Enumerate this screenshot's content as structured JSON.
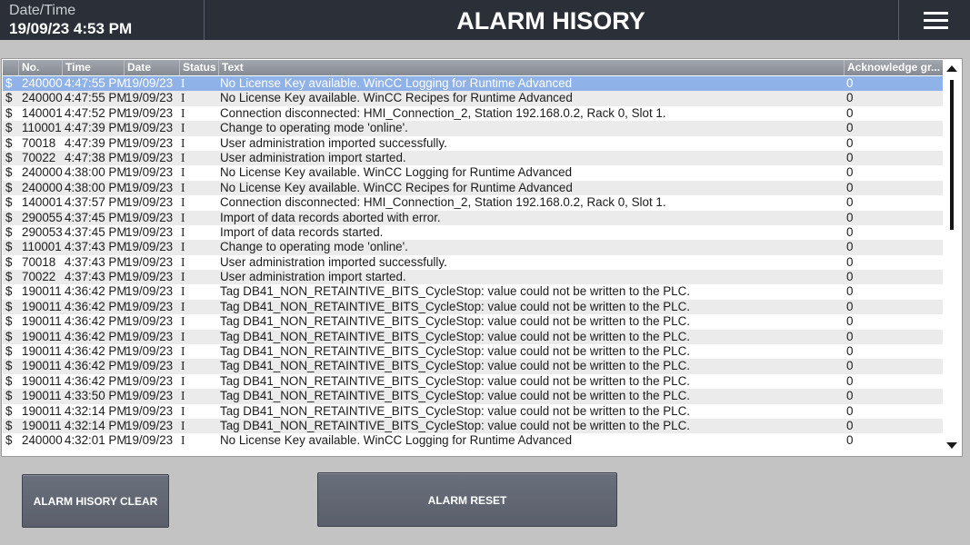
{
  "header": {
    "datetime_label": "Date/Time",
    "datetime_value": "19/09/23 4:53 PM",
    "title": "ALARM HISORY",
    "menu_icon": "hamburger-menu-icon"
  },
  "alarm_view": {
    "columns": {
      "no": "No.",
      "time": "Time",
      "date": "Date",
      "status": "Status",
      "text": "Text",
      "ack": "Acknowledge gr..."
    },
    "selected_row": 0,
    "rows": [
      {
        "icon": "$",
        "no": "240000",
        "time": "4:47:55 PM",
        "date": "19/09/23",
        "status": "I",
        "text": "No License Key available. WinCC Logging for Runtime Advanced",
        "ack": "0"
      },
      {
        "icon": "$",
        "no": "240000",
        "time": "4:47:55 PM",
        "date": "19/09/23",
        "status": "I",
        "text": "No License Key available. WinCC Recipes for Runtime Advanced",
        "ack": "0"
      },
      {
        "icon": "$",
        "no": "140001",
        "time": "4:47:52 PM",
        "date": "19/09/23",
        "status": "I",
        "text": "Connection disconnected: HMI_Connection_2, Station 192.168.0.2, Rack 0, Slot 1.",
        "ack": "0"
      },
      {
        "icon": "$",
        "no": "110001",
        "time": "4:47:39 PM",
        "date": "19/09/23",
        "status": "I",
        "text": "Change to operating mode 'online'.",
        "ack": "0"
      },
      {
        "icon": "$",
        "no": "70018",
        "time": "4:47:39 PM",
        "date": "19/09/23",
        "status": "I",
        "text": "User administration imported successfully.",
        "ack": "0"
      },
      {
        "icon": "$",
        "no": "70022",
        "time": "4:47:38 PM",
        "date": "19/09/23",
        "status": "I",
        "text": "User administration import started.",
        "ack": "0"
      },
      {
        "icon": "$",
        "no": "240000",
        "time": "4:38:00 PM",
        "date": "19/09/23",
        "status": "I",
        "text": "No License Key available. WinCC Logging for Runtime Advanced",
        "ack": "0"
      },
      {
        "icon": "$",
        "no": "240000",
        "time": "4:38:00 PM",
        "date": "19/09/23",
        "status": "I",
        "text": "No License Key available. WinCC Recipes for Runtime Advanced",
        "ack": "0"
      },
      {
        "icon": "$",
        "no": "140001",
        "time": "4:37:57 PM",
        "date": "19/09/23",
        "status": "I",
        "text": "Connection disconnected: HMI_Connection_2, Station 192.168.0.2, Rack 0, Slot 1.",
        "ack": "0"
      },
      {
        "icon": "$",
        "no": "290055",
        "time": "4:37:45 PM",
        "date": "19/09/23",
        "status": "I",
        "text": "Import of data records aborted with error.",
        "ack": "0"
      },
      {
        "icon": "$",
        "no": "290053",
        "time": "4:37:45 PM",
        "date": "19/09/23",
        "status": "I",
        "text": "Import of data records started.",
        "ack": "0"
      },
      {
        "icon": "$",
        "no": "110001",
        "time": "4:37:43 PM",
        "date": "19/09/23",
        "status": "I",
        "text": "Change to operating mode 'online'.",
        "ack": "0"
      },
      {
        "icon": "$",
        "no": "70018",
        "time": "4:37:43 PM",
        "date": "19/09/23",
        "status": "I",
        "text": "User administration imported successfully.",
        "ack": "0"
      },
      {
        "icon": "$",
        "no": "70022",
        "time": "4:37:43 PM",
        "date": "19/09/23",
        "status": "I",
        "text": "User administration import started.",
        "ack": "0"
      },
      {
        "icon": "$",
        "no": "190011",
        "time": "4:36:42 PM",
        "date": "19/09/23",
        "status": "I",
        "text": "Tag DB41_NON_RETAINTIVE_BITS_CycleStop: value could not be written to the PLC.",
        "ack": "0"
      },
      {
        "icon": "$",
        "no": "190011",
        "time": "4:36:42 PM",
        "date": "19/09/23",
        "status": "I",
        "text": "Tag DB41_NON_RETAINTIVE_BITS_CycleStop: value could not be written to the PLC.",
        "ack": "0"
      },
      {
        "icon": "$",
        "no": "190011",
        "time": "4:36:42 PM",
        "date": "19/09/23",
        "status": "I",
        "text": "Tag DB41_NON_RETAINTIVE_BITS_CycleStop: value could not be written to the PLC.",
        "ack": "0"
      },
      {
        "icon": "$",
        "no": "190011",
        "time": "4:36:42 PM",
        "date": "19/09/23",
        "status": "I",
        "text": "Tag DB41_NON_RETAINTIVE_BITS_CycleStop: value could not be written to the PLC.",
        "ack": "0"
      },
      {
        "icon": "$",
        "no": "190011",
        "time": "4:36:42 PM",
        "date": "19/09/23",
        "status": "I",
        "text": "Tag DB41_NON_RETAINTIVE_BITS_CycleStop: value could not be written to the PLC.",
        "ack": "0"
      },
      {
        "icon": "$",
        "no": "190011",
        "time": "4:36:42 PM",
        "date": "19/09/23",
        "status": "I",
        "text": "Tag DB41_NON_RETAINTIVE_BITS_CycleStop: value could not be written to the PLC.",
        "ack": "0"
      },
      {
        "icon": "$",
        "no": "190011",
        "time": "4:36:42 PM",
        "date": "19/09/23",
        "status": "I",
        "text": "Tag DB41_NON_RETAINTIVE_BITS_CycleStop: value could not be written to the PLC.",
        "ack": "0"
      },
      {
        "icon": "$",
        "no": "190011",
        "time": "4:33:50 PM",
        "date": "19/09/23",
        "status": "I",
        "text": "Tag DB41_NON_RETAINTIVE_BITS_CycleStop: value could not be written to the PLC.",
        "ack": "0"
      },
      {
        "icon": "$",
        "no": "190011",
        "time": "4:32:14 PM",
        "date": "19/09/23",
        "status": "I",
        "text": "Tag DB41_NON_RETAINTIVE_BITS_CycleStop: value could not be written to the PLC.",
        "ack": "0"
      },
      {
        "icon": "$",
        "no": "190011",
        "time": "4:32:14 PM",
        "date": "19/09/23",
        "status": "I",
        "text": "Tag DB41_NON_RETAINTIVE_BITS_CycleStop: value could not be written to the PLC.",
        "ack": "0"
      },
      {
        "icon": "$",
        "no": "240000",
        "time": "4:32:01 PM",
        "date": "19/09/23",
        "status": "I",
        "text": "No License Key available. WinCC Logging for Runtime Advanced",
        "ack": "0"
      }
    ]
  },
  "buttons": {
    "clear_label": "ALARM HISORY CLEAR",
    "reset_label": "ALARM RESET"
  },
  "colors": {
    "header_bg": "#2b3038",
    "body_bg": "#c3c3c3",
    "selected_row": "#8fb2e8",
    "button_bg": "#636874"
  }
}
